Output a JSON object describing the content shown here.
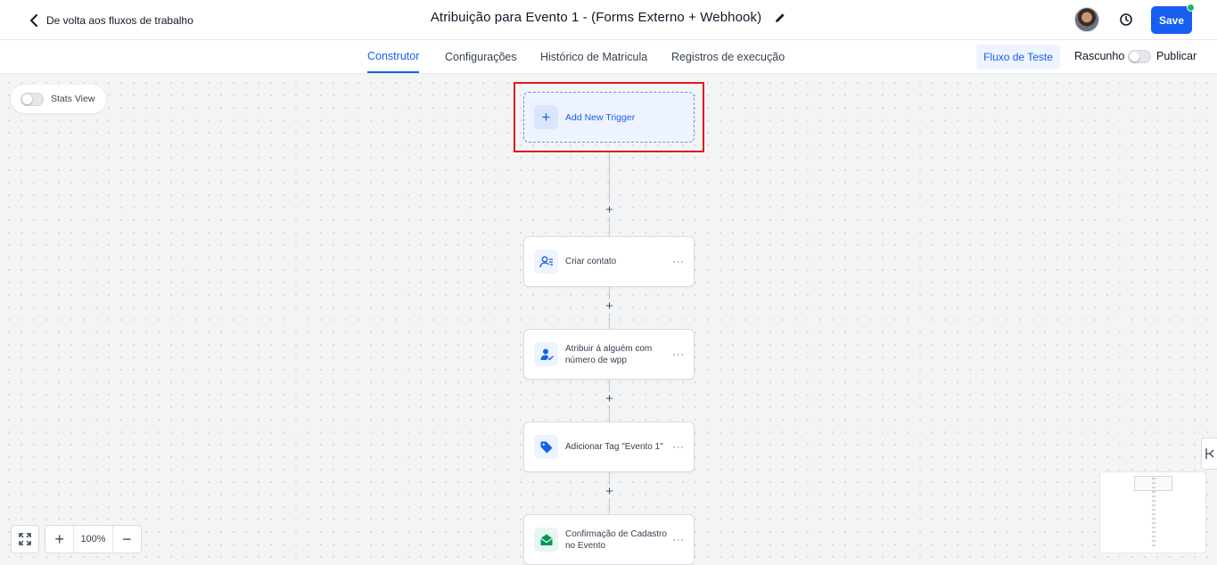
{
  "header": {
    "back_label": "De volta aos fluxos de trabalho",
    "title": "Atribuição para Evento 1 - (Forms Externo + Webhook)",
    "save_label": "Save"
  },
  "tabs": [
    {
      "label": "Construtor",
      "active": true
    },
    {
      "label": "Configurações",
      "active": false
    },
    {
      "label": "Histórico de Matricula",
      "active": false
    },
    {
      "label": "Registros de execução",
      "active": false
    }
  ],
  "toolbar": {
    "test_flow_label": "Fluxo de Teste",
    "draft_label": "Rascunho",
    "publish_label": "Publicar",
    "published": false
  },
  "canvas": {
    "stats_view_label": "Stats View",
    "stats_view_on": false,
    "trigger_label": "Add New Trigger",
    "actions": [
      {
        "label": "Criar contato",
        "icon": "user-list-icon"
      },
      {
        "label": "Atribuir á alguém com número de wpp",
        "icon": "user-assign-icon"
      },
      {
        "label": "Adicionar Tag \"Evento 1\"",
        "icon": "tag-icon"
      },
      {
        "label": "Confirmação de Cadastro no Evento",
        "icon": "email-open-icon"
      }
    ],
    "zoom_level": "100%"
  },
  "colors": {
    "accent": "#155eef",
    "highlight_border": "#e01b1b",
    "status_dot": "#12b76a"
  }
}
